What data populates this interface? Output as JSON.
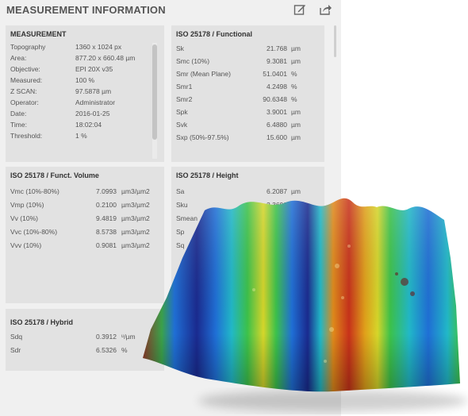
{
  "header": {
    "title": "MEASUREMENT INFORMATION",
    "edit_icon": "edit-icon",
    "share_icon": "share-icon"
  },
  "panels": {
    "measurement": {
      "title": "MEASUREMENT",
      "rows": [
        {
          "label": "Topography",
          "value": "1360 x 1024 px"
        },
        {
          "label": "Area:",
          "value": "877.20 x 660.48 µm"
        },
        {
          "label": "Objective:",
          "value": "EPI 20X v35"
        },
        {
          "label": "Measured:",
          "value": "100 %"
        },
        {
          "label": "Z SCAN:",
          "value": "97.5878 µm"
        },
        {
          "label": "Operator:",
          "value": "Administrator"
        },
        {
          "label": "Date:",
          "value": "2016-01-25"
        },
        {
          "label": "Time:",
          "value": "18:02:04"
        },
        {
          "label": "Threshold:",
          "value": "1 %"
        }
      ]
    },
    "functional": {
      "title": "ISO 25178 / Functional",
      "rows": [
        {
          "label": "Sk",
          "value": "21.768",
          "unit": "µm"
        },
        {
          "label": "Smc (10%)",
          "value": "9.3081",
          "unit": "µm"
        },
        {
          "label": "Smr (Mean Plane)",
          "value": "51.0401",
          "unit": "%"
        },
        {
          "label": "Smr1",
          "value": "4.2498",
          "unit": "%"
        },
        {
          "label": "Smr2",
          "value": "90.6348",
          "unit": "%"
        },
        {
          "label": "Spk",
          "value": "3.9001",
          "unit": "µm"
        },
        {
          "label": "Svk",
          "value": "6.4880",
          "unit": "µm"
        },
        {
          "label": "Sxp (50%-97.5%)",
          "value": "15.600",
          "unit": "µm"
        }
      ]
    },
    "funct_volume": {
      "title": "ISO 25178 / Funct. Volume",
      "rows": [
        {
          "label": "Vmc (10%-80%)",
          "value": "7.0993",
          "unit": "µm3/µm2"
        },
        {
          "label": "Vmp (10%)",
          "value": "0.2100",
          "unit": "µm3/µm2"
        },
        {
          "label": "Vv (10%)",
          "value": "9.4819",
          "unit": "µm3/µm2"
        },
        {
          "label": "Vvc (10%-80%)",
          "value": "8.5738",
          "unit": "µm3/µm2"
        },
        {
          "label": "Vvv (10%)",
          "value": "0.9081",
          "unit": "µm3/µm2"
        }
      ]
    },
    "height": {
      "title": "ISO 25178 / Height",
      "rows": [
        {
          "label": "Sa",
          "value": "6.2087",
          "unit": "µm"
        },
        {
          "label": "Sku",
          "value": "2.3692",
          "unit": ""
        },
        {
          "label": "Smean",
          "value": "",
          "unit": ""
        },
        {
          "label": "Sp",
          "value": "",
          "unit": ""
        },
        {
          "label": "Sq",
          "value": "",
          "unit": ""
        }
      ]
    },
    "hybrid": {
      "title": "ISO 25178 / Hybrid",
      "rows": [
        {
          "label": "Sdq",
          "value": "0.3912",
          "unit": "ᵘ/µm"
        },
        {
          "label": "Sdr",
          "value": "6.5326",
          "unit": "%"
        }
      ]
    }
  },
  "terrain_image": {
    "name": "3d-surface-topography",
    "colormap": [
      "#1a2a8f",
      "#1f6fd6",
      "#21b8c8",
      "#3cc24a",
      "#d6d62a",
      "#e08a1a",
      "#c8321a"
    ]
  }
}
